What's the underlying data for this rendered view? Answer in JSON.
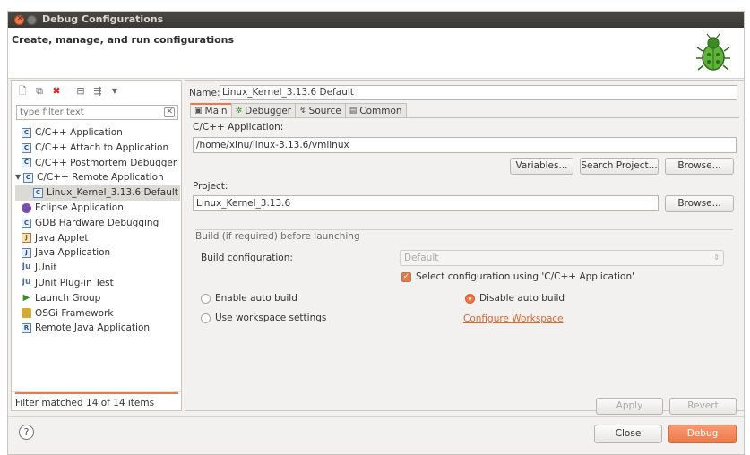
{
  "window": {
    "title": "Debug Configurations"
  },
  "header": {
    "title": "Create, manage, and run configurations"
  },
  "left": {
    "filter_placeholder": "type filter text",
    "items": [
      {
        "label": "C/C++ Application"
      },
      {
        "label": "C/C++ Attach to Application"
      },
      {
        "label": "C/C++ Postmortem Debugger"
      },
      {
        "label": "C/C++ Remote Application"
      },
      {
        "label": "Linux_Kernel_3.13.6 Default"
      },
      {
        "label": "Eclipse Application"
      },
      {
        "label": "GDB Hardware Debugging"
      },
      {
        "label": "Java Applet"
      },
      {
        "label": "Java Application"
      },
      {
        "label": "JUnit"
      },
      {
        "label": "JUnit Plug-in Test"
      },
      {
        "label": "Launch Group"
      },
      {
        "label": "OSGi Framework"
      },
      {
        "label": "Remote Java Application"
      }
    ],
    "status": "Filter matched 14 of 14 items"
  },
  "right": {
    "name_label": "Name:",
    "name_value": "Linux_Kernel_3.13.6 Default",
    "tabs": [
      {
        "label": "Main"
      },
      {
        "label": "Debugger"
      },
      {
        "label": "Source"
      },
      {
        "label": "Common"
      }
    ],
    "app_label": "C/C++ Application:",
    "app_value": "/home/xinu/linux-3.13.6/vmlinux",
    "variables_button": "Variables...",
    "search_project_button": "Search Project...",
    "browse_button": "Browse...",
    "project_label": "Project:",
    "project_value": "Linux_Kernel_3.13.6",
    "project_browse_button": "Browse...",
    "build_group_title": "Build (if required) before launching",
    "build_config_label": "Build configuration:",
    "build_config_value": "Default",
    "select_config_label": "Select configuration using 'C/C++ Application'",
    "enable_auto_build": "Enable auto build",
    "disable_auto_build": "Disable auto build",
    "use_workspace_settings": "Use workspace settings",
    "configure_workspace": "Configure Workspace",
    "apply_button": "Apply",
    "revert_button": "Revert"
  },
  "footer": {
    "help": "?",
    "close_button": "Close",
    "debug_button": "Debug"
  },
  "colors": {
    "accent": "#f07746",
    "titlebar": "#3c3b37",
    "link": "#e0662a"
  }
}
